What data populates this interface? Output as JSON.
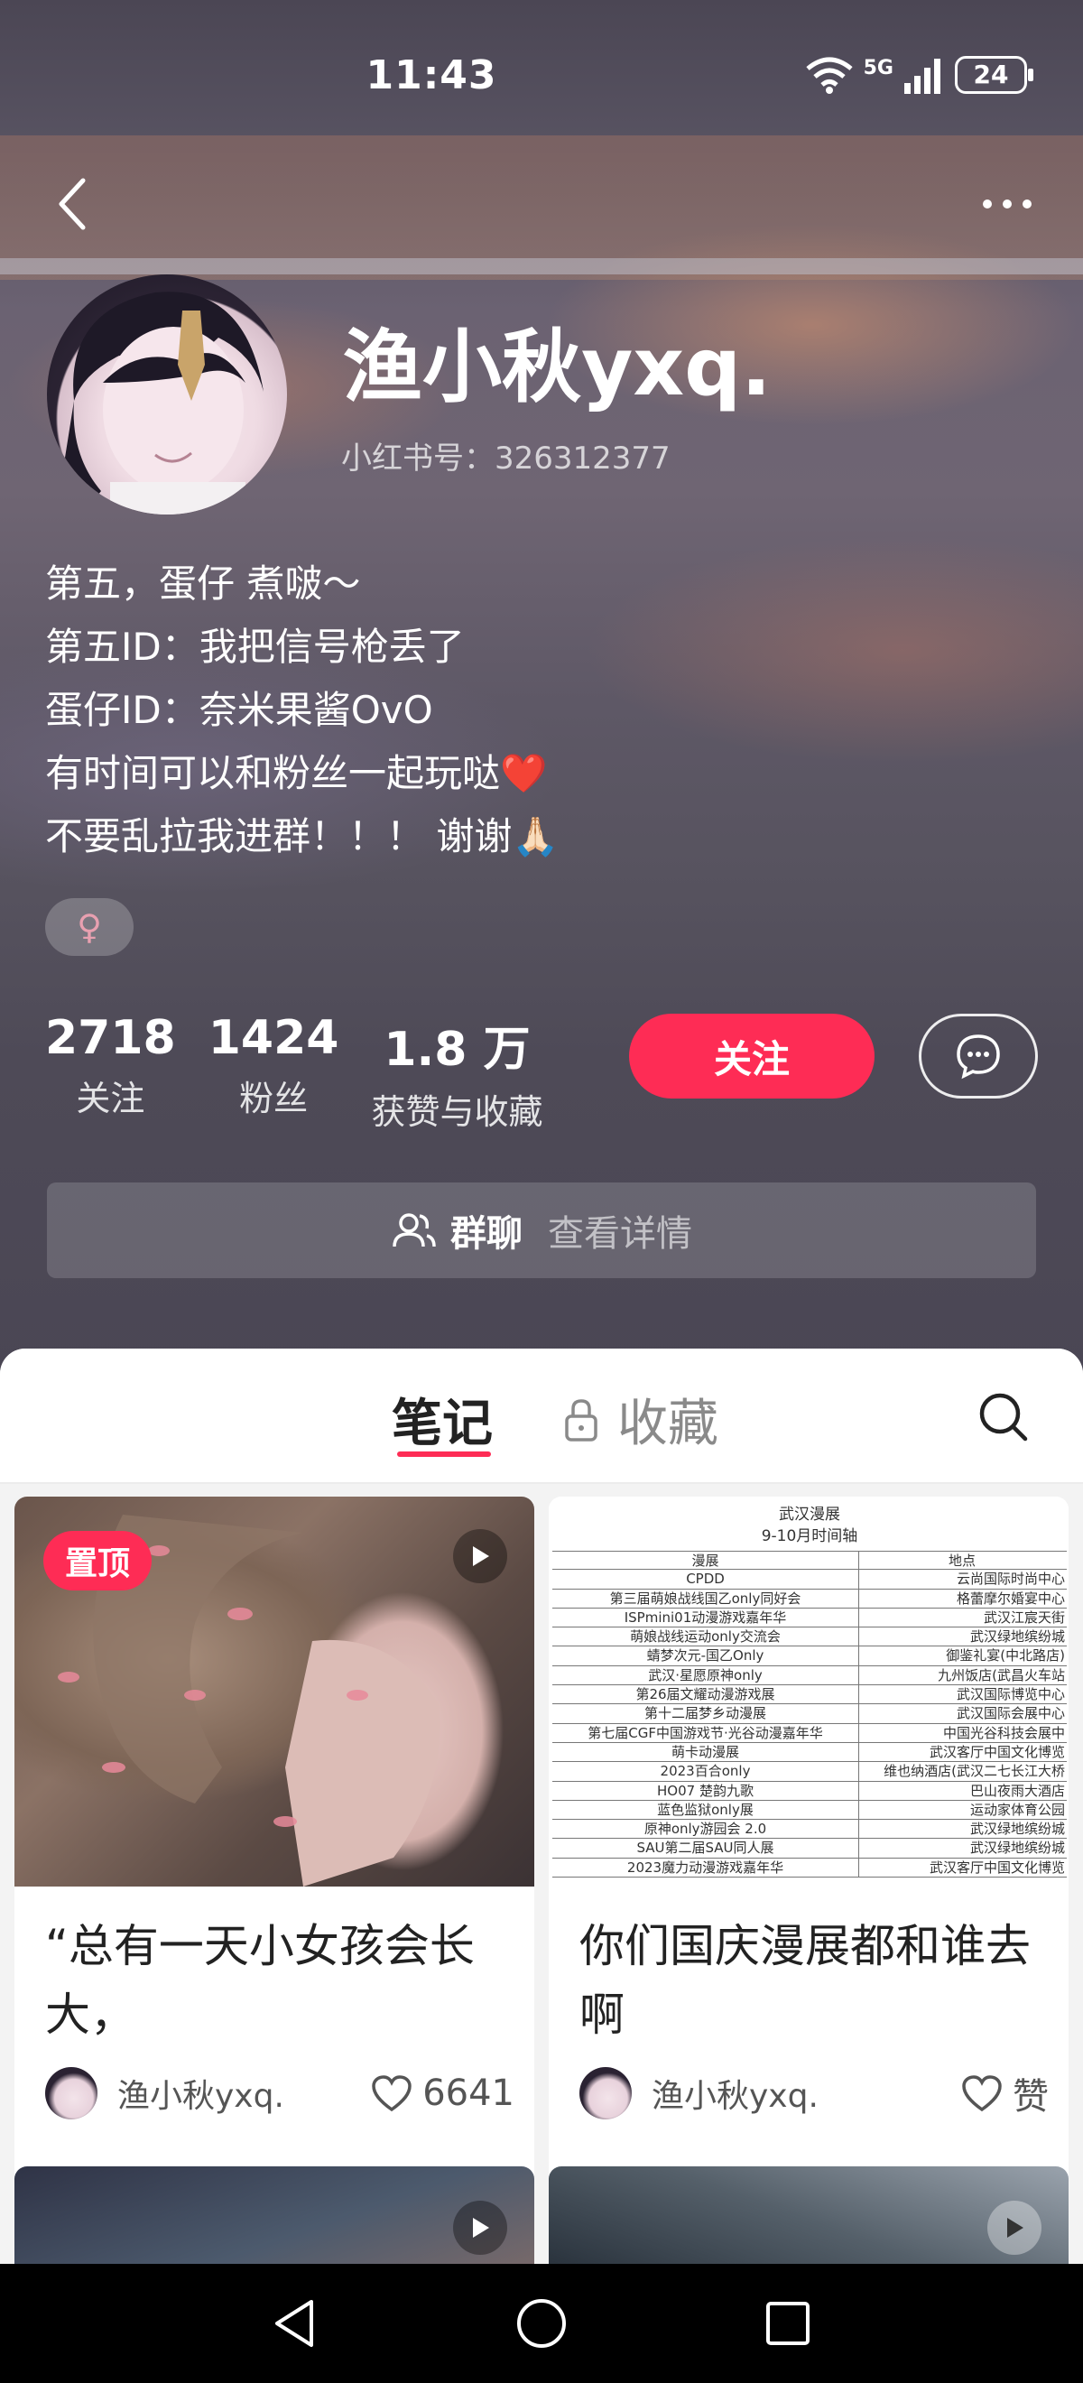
{
  "status_bar": {
    "time": "11:43",
    "network": "5G",
    "battery": "24"
  },
  "header": {
    "back_icon": "chevron-left-icon",
    "more_icon": "more-dots-icon"
  },
  "profile": {
    "username": "渔小秋yxq.",
    "account_id": "小红书号：326312377",
    "bio": [
      "第五，蛋仔 煮啵～",
      "第五ID：我把信号枪丢了",
      "蛋仔ID：奈米果酱OvO",
      "有时间可以和粉丝一起玩哒❤️",
      "不要乱拉我进群！！！ 谢谢🙏🏻"
    ],
    "gender_symbol": "♀",
    "gender_color": "#e8a0b0"
  },
  "stats": [
    {
      "value": "2718",
      "label": "关注"
    },
    {
      "value": "1424",
      "label": "粉丝"
    },
    {
      "value": "1.8 万",
      "label": "获赞与收藏"
    }
  ],
  "actions": {
    "follow_label": "关注",
    "follow_color": "#fe2c55",
    "chat_icon": "message-bubble-icon"
  },
  "group_chat": {
    "label": "群聊",
    "detail": "查看详情"
  },
  "tabs": {
    "notes": "笔记",
    "collections": "收藏"
  },
  "notes": [
    {
      "pinned_label": "置顶",
      "title": "“总有一天小女孩会长大，",
      "author": "渔小秋yxq.",
      "likes": "6641",
      "is_video": true
    },
    {
      "title": "你们国庆漫展都和谁去啊",
      "author": "渔小秋yxq.",
      "likes": "赞",
      "is_video": false,
      "image_table": {
        "title": "武汉漫展",
        "subtitle": "9-10月时间轴",
        "headers": [
          "漫展",
          "地点"
        ],
        "rows": [
          [
            "CPDD",
            "云尚国际时尚中心"
          ],
          [
            "第三届萌娘战线国乙only同好会",
            "格蕾摩尔婚宴中心"
          ],
          [
            "ISPmini01动漫游戏嘉年华",
            "武汉江宸天街"
          ],
          [
            "萌娘战线运动only交流会",
            "武汉绿地缤纷城"
          ],
          [
            "蜻梦次元-国乙Only",
            "御鉴礼宴(中北路店)"
          ],
          [
            "武汉·星愿原神only",
            "九州饭店(武昌火车站"
          ],
          [
            "第26届文耀动漫游戏展",
            "武汉国际博览中心"
          ],
          [
            "第十二届梦乡动漫展",
            "武汉国际会展中心"
          ],
          [
            "第七届CGF中国游戏节·光谷动漫嘉年华",
            "中国光谷科技会展中"
          ],
          [
            "萌卡动漫展",
            "武汉客厅中国文化博览"
          ],
          [
            "2023百合only",
            "维也纳酒店(武汉二七长江大桥"
          ],
          [
            "HO07 楚韵九歌",
            "巴山夜雨大酒店"
          ],
          [
            "蓝色监狱only展",
            "运动家体育公园"
          ],
          [
            "原神only游园会 2.0",
            "武汉绿地缤纷城"
          ],
          [
            "SAU第二届SAU同人展",
            "武汉绿地缤纷城"
          ],
          [
            "2023魔力动漫游戏嘉年华",
            "武汉客厅中国文化博览"
          ]
        ]
      }
    }
  ],
  "nav": {
    "back": "triangle-back-icon",
    "home": "circle-home-icon",
    "recents": "square-recents-icon"
  }
}
